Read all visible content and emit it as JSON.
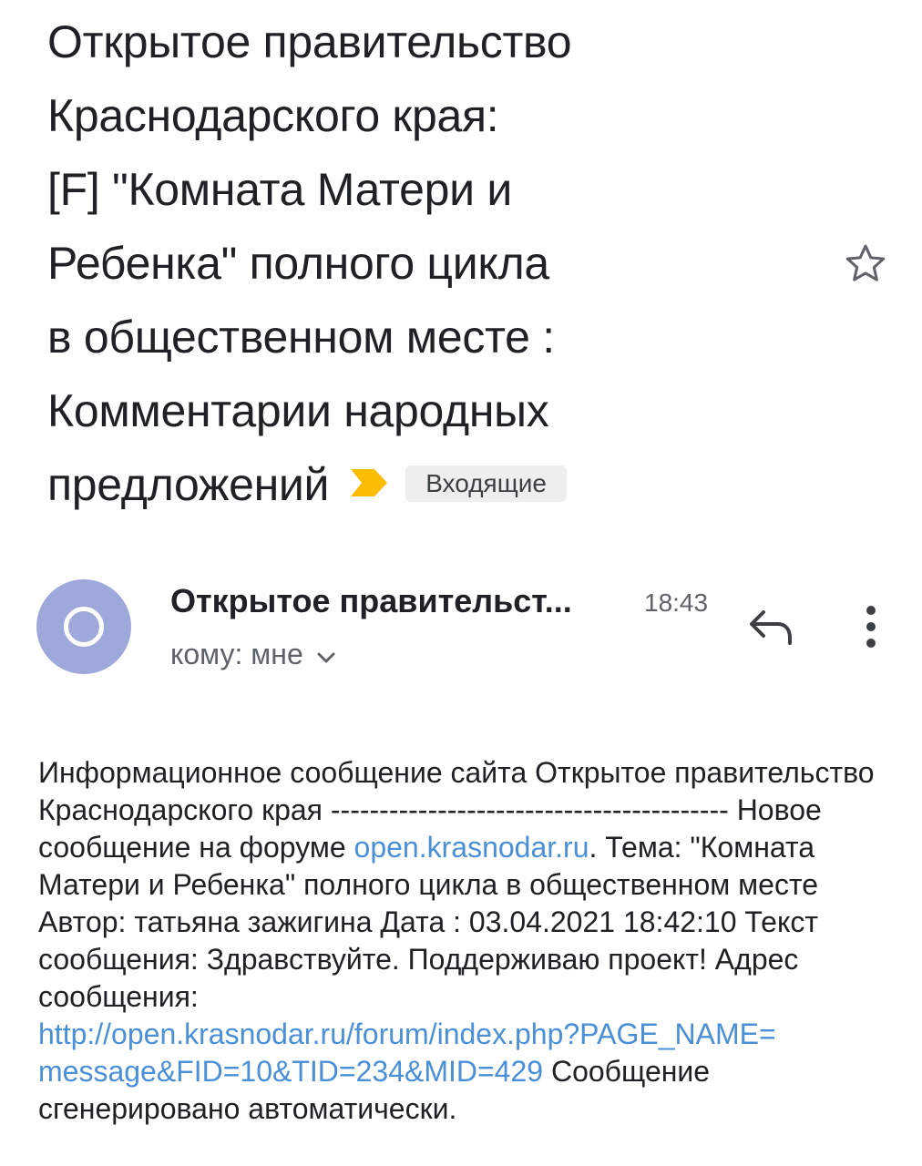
{
  "subject": {
    "lines": [
      "Открытое правительство",
      "Краснодарского края:",
      "[F] \"Комната Матери и",
      "Ребенка\" полного цикла",
      "в общественном месте :",
      "Комментарии народных",
      "предложений"
    ],
    "label": "Входящие",
    "star_icon": "star-outline-icon",
    "importance_icon": "importance-marker-icon",
    "importance_color": "#fbbc04"
  },
  "message_header": {
    "avatar_icon": "circle-avatar-icon",
    "avatar_color": "#9fa8da",
    "sender": "Открытое правительст...",
    "time": "18:43",
    "recipient": "кому: мне",
    "expand_icon": "chevron-down-icon",
    "reply_icon": "reply-icon",
    "more_icon": "more-vert-icon"
  },
  "body": {
    "part1": "Информационное сообщение сайта Открытое правительство Краснодарского края ----------------------------------------- Новое сообщение на форуме ",
    "link1": "open.krasnodar.ru",
    "part2": ". Тема: \"Комната Матери и Ребенка\" полного цикла в общественном месте Автор: татьяна зажигина Дата : 03.04.2021 18:42:10 Текст сообщения: Здравствуйте. Поддерживаю проект! Адрес сообщения: ",
    "link2_line1": "http://open.krasnodar.ru/forum/index.php?PAGE_NAME=",
    "link2_line2": "message&FID=10&TID=234&MID=429",
    "part3": " Сообщение сгенерировано автоматически.",
    "link_color": "#4a90d9"
  }
}
